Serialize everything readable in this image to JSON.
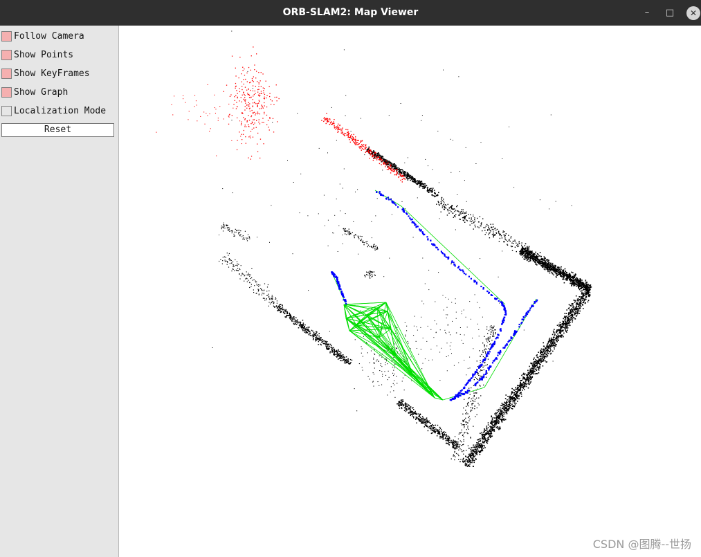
{
  "window": {
    "title": "ORB-SLAM2: Map Viewer",
    "controls": {
      "minimize": "–",
      "maximize": "□",
      "close": "✕"
    }
  },
  "panel": {
    "options": [
      {
        "label": "Follow Camera",
        "checked": true
      },
      {
        "label": "Show Points",
        "checked": true
      },
      {
        "label": "Show KeyFrames",
        "checked": true
      },
      {
        "label": "Show Graph",
        "checked": true
      },
      {
        "label": "Localization Mode",
        "checked": false
      }
    ],
    "reset_label": "Reset"
  },
  "colors": {
    "map_points": "#000000",
    "reference_points": "#ff0000",
    "keyframes": "#0000ff",
    "graph": "#00dd00",
    "checked": "#f5b0b0"
  },
  "watermark": "CSDN @图腾--世扬"
}
